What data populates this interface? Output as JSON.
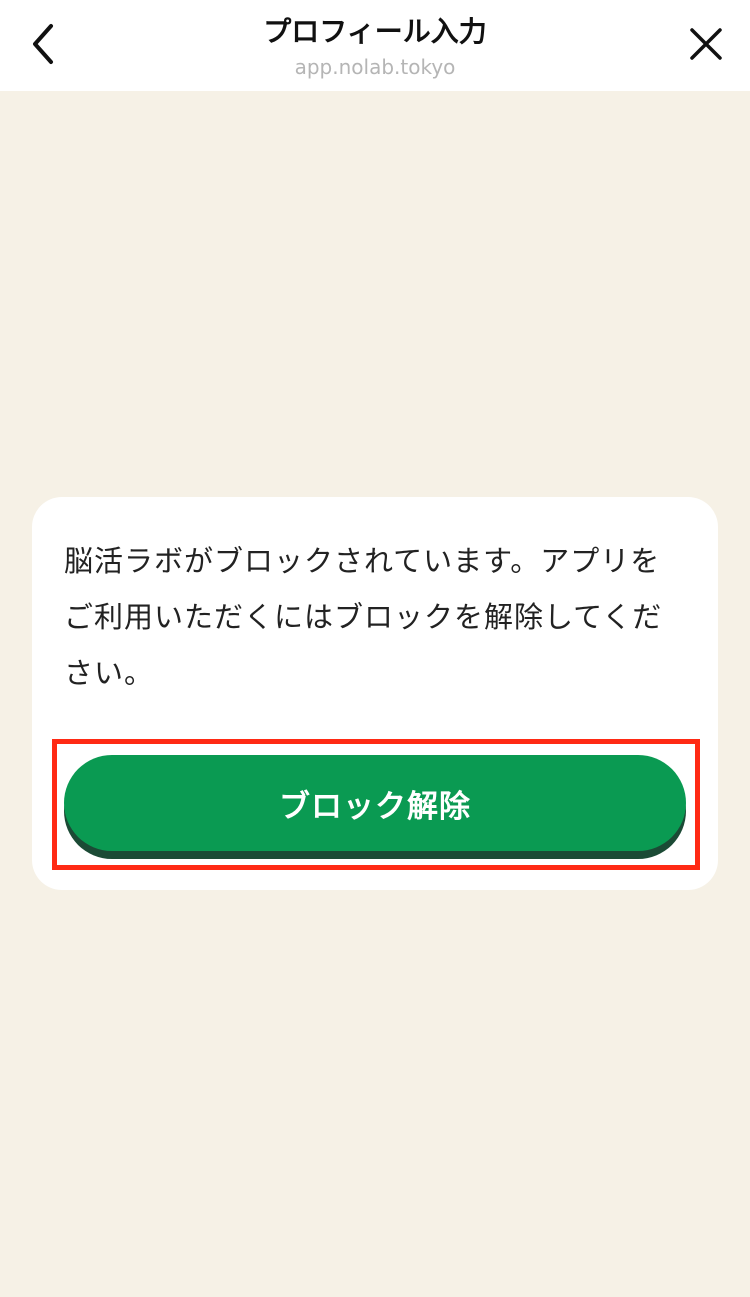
{
  "header": {
    "title": "プロフィール入力",
    "url": "app.nolab.tokyo",
    "back_icon": "chevron-left-icon",
    "close_icon": "close-icon"
  },
  "dialog": {
    "message": "脳活ラボがブロックされています。アプリをご利用いただくにはブロックを解除してください。",
    "button_label": "ブロック解除"
  },
  "colors": {
    "background": "#f6f1e6",
    "button": "#0a9a52",
    "button_shadow": "#1b4a35",
    "highlight": "#ff2a14"
  }
}
